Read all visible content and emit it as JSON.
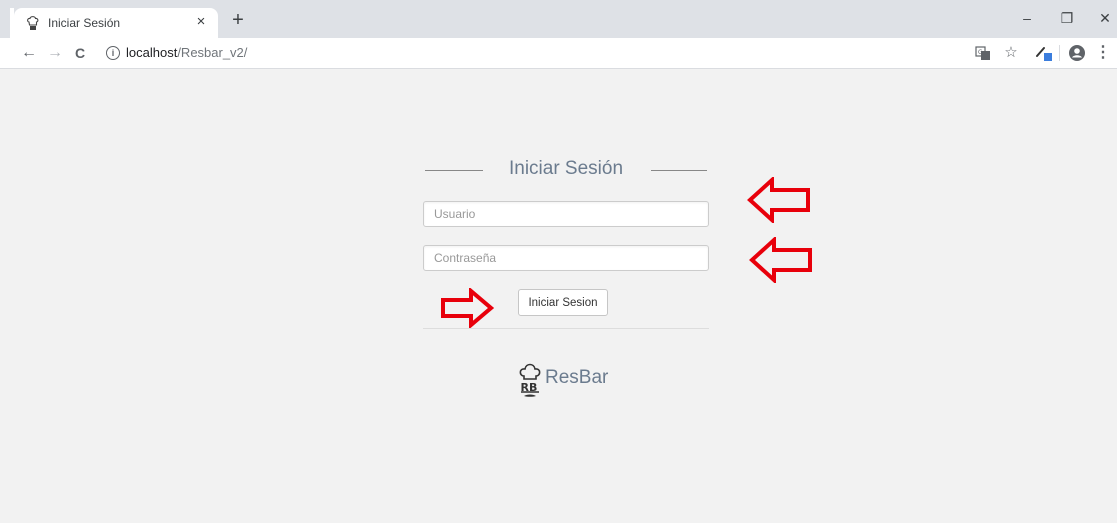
{
  "browser": {
    "tab": {
      "title": "Iniciar Sesión",
      "close_glyph": "×"
    },
    "new_tab_glyph": "+",
    "window_controls": {
      "minimize": "–",
      "restore": "❐",
      "close": "✕"
    },
    "nav": {
      "back": "←",
      "forward": "→",
      "reload": "C"
    },
    "address": {
      "host": "localhost",
      "path": "/Resbar_v2/"
    },
    "toolbar_icons": [
      "translate-icon",
      "star-icon",
      "extension-icon",
      "account-icon",
      "menu-icon"
    ],
    "toolbar_glyphs": {
      "star": "☆",
      "menu": "⋮"
    }
  },
  "login": {
    "title": "Iniciar Sesión",
    "username": {
      "value": "",
      "placeholder": "Usuario"
    },
    "password": {
      "value": "",
      "placeholder": "Contraseña"
    },
    "submit_label": "Iniciar Sesion"
  },
  "brand": {
    "name": "ResBar",
    "logo_text": "RB"
  },
  "annotations": {
    "arrow_color": "#e8000b"
  },
  "colors": {
    "title_text": "#6b7b8e",
    "page_bg": "#f2f2f2"
  }
}
